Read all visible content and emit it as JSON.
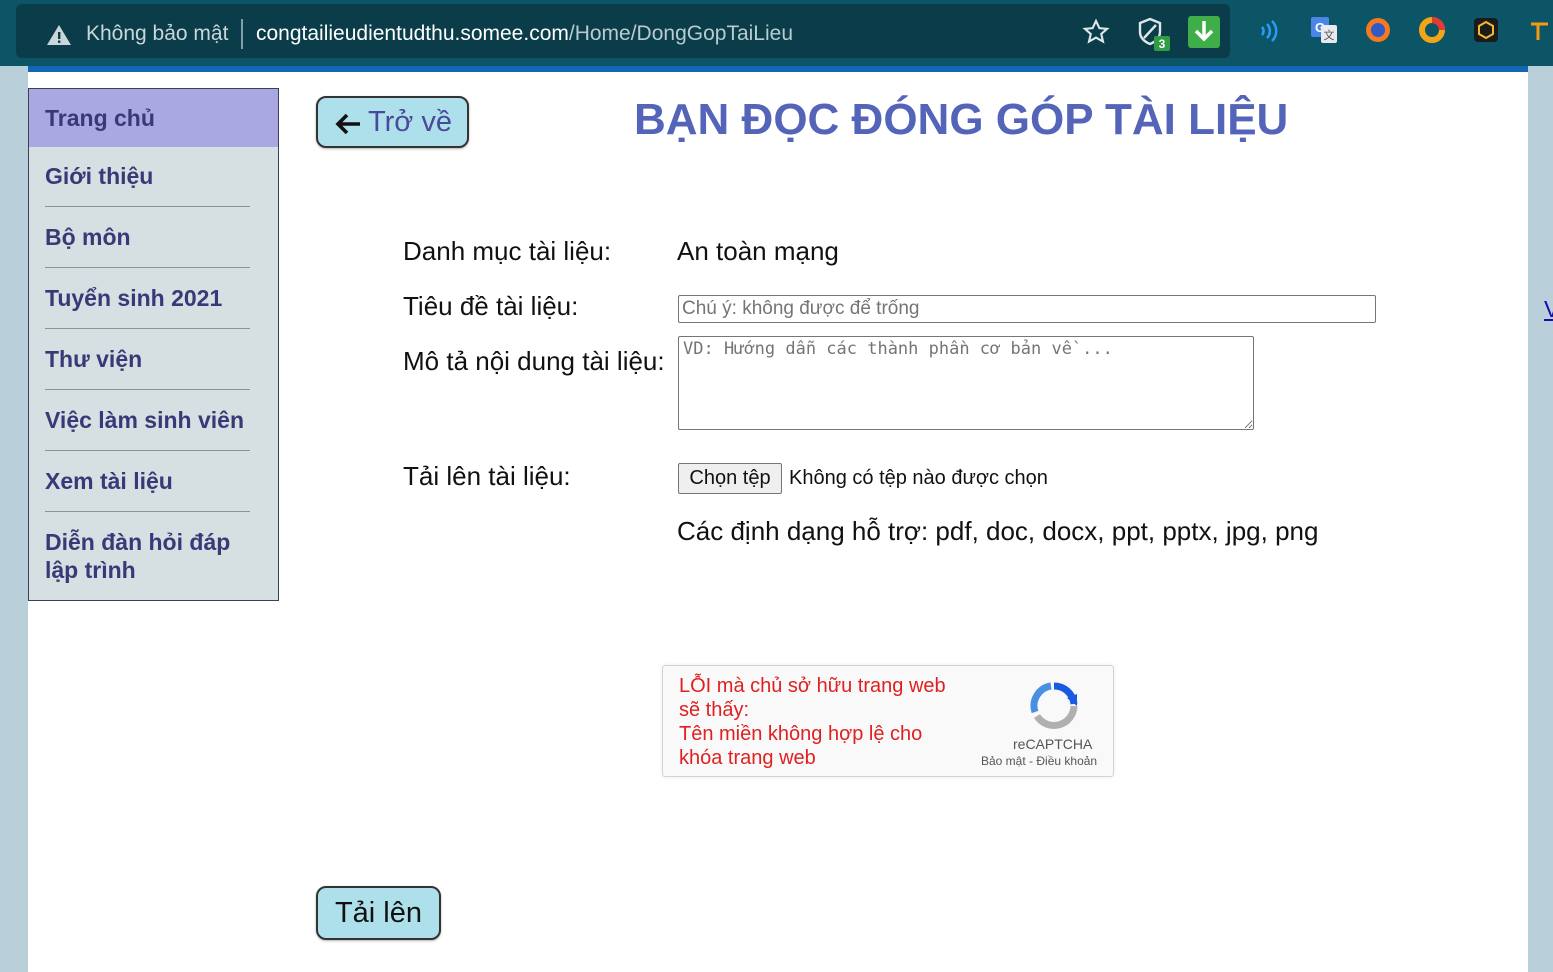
{
  "browser": {
    "security_label": "Không bảo mật",
    "url_host": "congtailieudientudthu.somee.com",
    "url_path": "/Home/DongGopTaiLieu",
    "shield_badge": "3",
    "icons": [
      "warning-icon",
      "bookmark-star-icon",
      "shield-extension-icon",
      "download-extension-icon",
      "wifi-extension-icon",
      "translate-extension-icon",
      "firefox-like-extension-icon",
      "donut-extension-icon",
      "cube-extension-icon",
      "tool-extension-icon"
    ]
  },
  "sidebar": {
    "items": [
      {
        "label": "Trang chủ",
        "active": true
      },
      {
        "label": "Giới thiệu"
      },
      {
        "label": "Bộ môn"
      },
      {
        "label": "Tuyển sinh 2021"
      },
      {
        "label": "Thư viện"
      },
      {
        "label": "Việc làm sinh viên"
      },
      {
        "label": "Xem tài liệu"
      },
      {
        "label": "Diễn đàn hỏi đáp lập trình"
      }
    ]
  },
  "header": {
    "back_label": "Trở về",
    "title": "BẠN ĐỌC ĐÓNG GÓP TÀI LIỆU"
  },
  "form": {
    "category_label": "Danh mục tài liệu:",
    "category_value": "An toàn mạng",
    "title_label": "Tiêu đề tài liệu:",
    "title_placeholder": "Chú ý: không được để trống",
    "desc_label": "Mô tả nội dung tài liệu:",
    "desc_placeholder": "VD: Hướng dẫn các thành phần cơ bản về ...",
    "upload_label": "Tải lên tài liệu:",
    "file_button": "Chọn tệp",
    "file_status": "Không có tệp nào được chọn",
    "formats_note": "Các định dạng hỗ trợ: pdf, doc, docx, ppt, pptx, jpg, png",
    "right_link": "V"
  },
  "recaptcha": {
    "error_line1": "LỖI mà chủ sở hữu trang web sẽ thấy:",
    "error_line2": "Tên miền không hợp lệ cho khóa trang web",
    "brand": "reCAPTCHA",
    "privacy": "Bảo mật",
    "separator": " - ",
    "terms": "Điều khoản"
  },
  "submit_label": "Tải lên"
}
